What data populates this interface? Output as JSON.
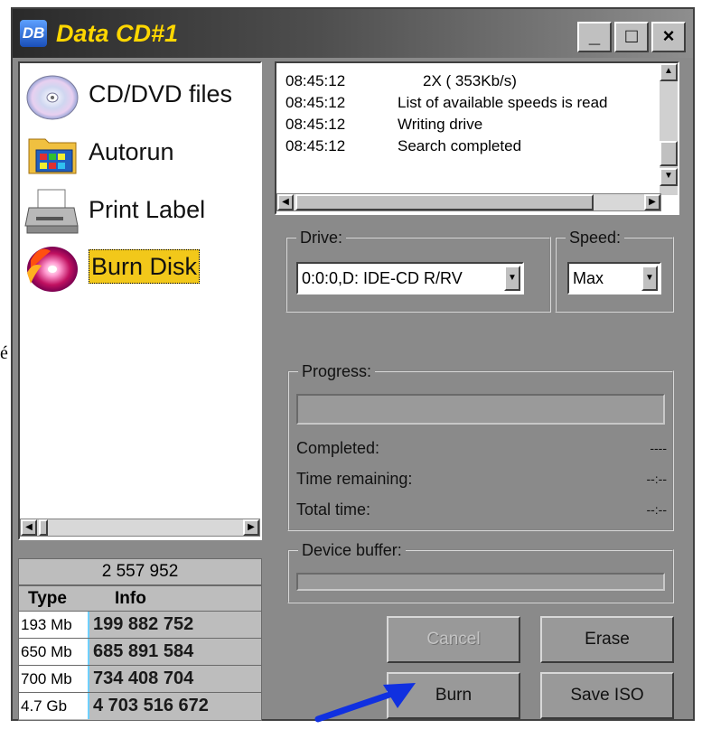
{
  "window": {
    "title": "Data CD#1",
    "logo_text": "DB",
    "buttons": {
      "minimize": "_",
      "maximize": "□",
      "close": "×"
    }
  },
  "stray_char": "é",
  "nav": {
    "items": [
      {
        "label": "CD/DVD files",
        "icon": "cd-icon"
      },
      {
        "label": "Autorun",
        "icon": "autorun-folder-icon"
      },
      {
        "label": "Print Label",
        "icon": "printer-icon"
      },
      {
        "label": "Burn Disk",
        "icon": "burn-disk-icon",
        "selected": true
      }
    ]
  },
  "summary": {
    "total": "2 557 952",
    "headers": {
      "type": "Type",
      "info": "Info"
    },
    "rows": [
      {
        "type": "193 Mb",
        "info": "199 882 752"
      },
      {
        "type": "650 Mb",
        "info": "685 891 584"
      },
      {
        "type": "700 Mb",
        "info": "734 408 704"
      },
      {
        "type": "4.7 Gb",
        "info": "4 703 516 672"
      }
    ]
  },
  "log": {
    "entries": [
      {
        "time": "08:45:12",
        "text": "2X ( 353Kb/s)"
      },
      {
        "time": "08:45:12",
        "text": "List of available speeds is read"
      },
      {
        "time": "08:45:12",
        "text": "Writing drive"
      },
      {
        "time": "08:45:12",
        "text": "Search completed"
      }
    ]
  },
  "drive": {
    "label": "Drive:",
    "value": "0:0:0,D: IDE-CD  R/RV"
  },
  "speed": {
    "label": "Speed:",
    "value": "Max"
  },
  "progress": {
    "label": "Progress:",
    "fraction": 0,
    "completed_label": "Completed:",
    "completed_value": "----",
    "remaining_label": "Time remaining:",
    "remaining_value": "--:--",
    "total_label": "Total time:",
    "total_value": "--:--"
  },
  "buffer": {
    "label": "Device buffer:",
    "fraction": 0
  },
  "actions": {
    "cancel": "Cancel",
    "erase": "Erase",
    "burn": "Burn",
    "save_iso": "Save ISO"
  },
  "colors": {
    "title_text": "#ffd700",
    "selected_bg": "#f2c81a",
    "panel_bg": "#8a8a8a",
    "pointer_arrow": "#1030e0"
  }
}
